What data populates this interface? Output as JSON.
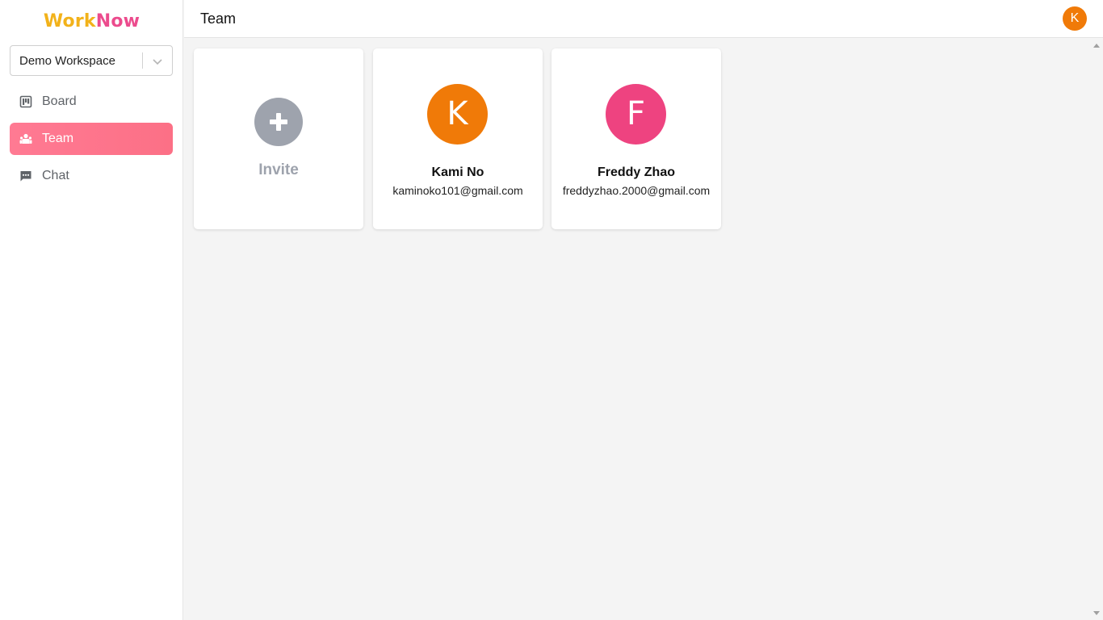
{
  "app": {
    "logo_part1": "Work",
    "logo_part2": "Now",
    "colors": {
      "logo_yellow": "#f2b21a",
      "logo_pink": "#ec4b8d",
      "active_nav": "#fc7086"
    }
  },
  "sidebar": {
    "workspace": {
      "selected": "Demo Workspace"
    },
    "items": [
      {
        "label": "Board",
        "icon": "board-icon",
        "active": false
      },
      {
        "label": "Team",
        "icon": "team-icon",
        "active": true
      },
      {
        "label": "Chat",
        "icon": "chat-icon",
        "active": false
      }
    ]
  },
  "header": {
    "title": "Team",
    "user_initial": "K",
    "user_avatar_color": "#f07a08"
  },
  "team": {
    "invite_label": "Invite",
    "members": [
      {
        "initial": "K",
        "name": "Kami No",
        "email": "kaminoko101@gmail.com",
        "color": "#f07a08"
      },
      {
        "initial": "F",
        "name": "Freddy Zhao",
        "email": "freddyzhao.2000@gmail.com",
        "color": "#ee4380"
      }
    ]
  }
}
